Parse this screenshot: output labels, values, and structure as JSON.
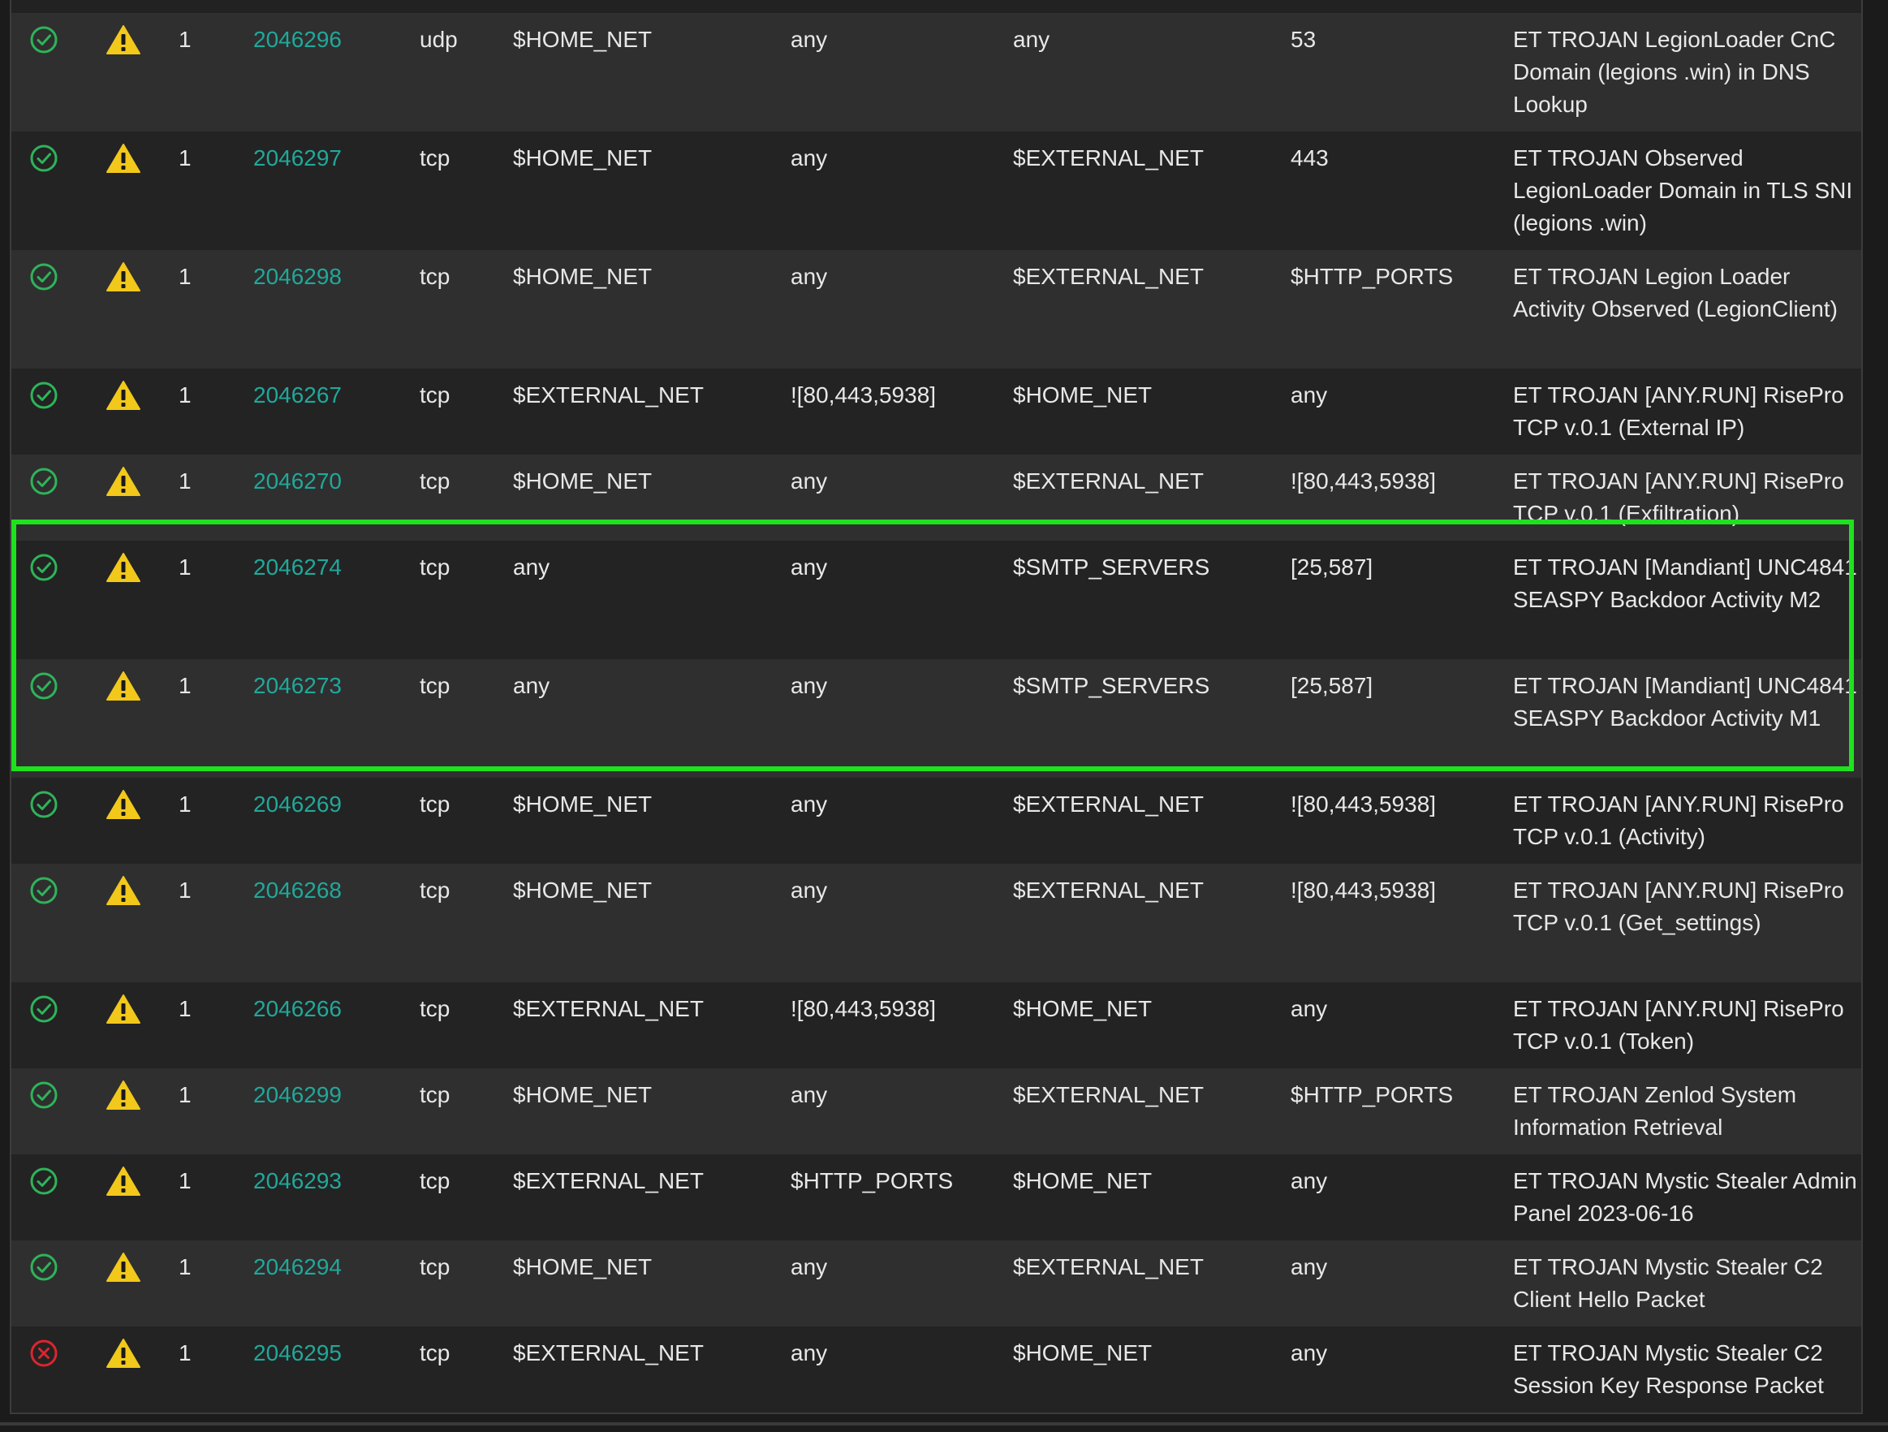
{
  "rules": [
    {
      "state": "enabled",
      "gid": "1",
      "sid": "2046296",
      "proto": "udp",
      "src": "$HOME_NET",
      "src_port": "any",
      "dst": "any",
      "dst_port": "53",
      "msg": "ET TROJAN LegionLoader CnC Domain (legions .win) in DNS Lookup"
    },
    {
      "state": "enabled",
      "gid": "1",
      "sid": "2046297",
      "proto": "tcp",
      "src": "$HOME_NET",
      "src_port": "any",
      "dst": "$EXTERNAL_NET",
      "dst_port": "443",
      "msg": "ET TROJAN Observed LegionLoader Domain in TLS SNI (legions .win)"
    },
    {
      "state": "enabled",
      "gid": "1",
      "sid": "2046298",
      "proto": "tcp",
      "src": "$HOME_NET",
      "src_port": "any",
      "dst": "$EXTERNAL_NET",
      "dst_port": "$HTTP_PORTS",
      "msg": "ET TROJAN Legion Loader Activity Observed (LegionClient)"
    },
    {
      "state": "enabled",
      "gid": "1",
      "sid": "2046267",
      "proto": "tcp",
      "src": "$EXTERNAL_NET",
      "src_port": "![80,443,5938]",
      "dst": "$HOME_NET",
      "dst_port": "any",
      "msg": "ET TROJAN [ANY.RUN] RisePro TCP v.0.1 (External IP)"
    },
    {
      "state": "enabled",
      "gid": "1",
      "sid": "2046270",
      "proto": "tcp",
      "src": "$HOME_NET",
      "src_port": "any",
      "dst": "$EXTERNAL_NET",
      "dst_port": "![80,443,5938]",
      "msg": "ET TROJAN [ANY.RUN] RisePro TCP v.0.1 (Exfiltration)"
    },
    {
      "state": "enabled",
      "gid": "1",
      "sid": "2046274",
      "proto": "tcp",
      "src": "any",
      "src_port": "any",
      "dst": "$SMTP_SERVERS",
      "dst_port": "[25,587]",
      "msg": "ET TROJAN [Mandiant] UNC4841 SEASPY Backdoor Activity M2"
    },
    {
      "state": "enabled",
      "gid": "1",
      "sid": "2046273",
      "proto": "tcp",
      "src": "any",
      "src_port": "any",
      "dst": "$SMTP_SERVERS",
      "dst_port": "[25,587]",
      "msg": "ET TROJAN [Mandiant] UNC4841 SEASPY Backdoor Activity M1"
    },
    {
      "state": "enabled",
      "gid": "1",
      "sid": "2046269",
      "proto": "tcp",
      "src": "$HOME_NET",
      "src_port": "any",
      "dst": "$EXTERNAL_NET",
      "dst_port": "![80,443,5938]",
      "msg": "ET TROJAN [ANY.RUN] RisePro TCP v.0.1 (Activity)"
    },
    {
      "state": "enabled",
      "gid": "1",
      "sid": "2046268",
      "proto": "tcp",
      "src": "$HOME_NET",
      "src_port": "any",
      "dst": "$EXTERNAL_NET",
      "dst_port": "![80,443,5938]",
      "msg": "ET TROJAN [ANY.RUN] RisePro TCP v.0.1 (Get_settings)"
    },
    {
      "state": "enabled",
      "gid": "1",
      "sid": "2046266",
      "proto": "tcp",
      "src": "$EXTERNAL_NET",
      "src_port": "![80,443,5938]",
      "dst": "$HOME_NET",
      "dst_port": "any",
      "msg": "ET TROJAN [ANY.RUN] RisePro TCP v.0.1 (Token)"
    },
    {
      "state": "enabled",
      "gid": "1",
      "sid": "2046299",
      "proto": "tcp",
      "src": "$HOME_NET",
      "src_port": "any",
      "dst": "$EXTERNAL_NET",
      "dst_port": "$HTTP_PORTS",
      "msg": "ET TROJAN Zenlod System Information Retrieval"
    },
    {
      "state": "enabled",
      "gid": "1",
      "sid": "2046293",
      "proto": "tcp",
      "src": "$EXTERNAL_NET",
      "src_port": "$HTTP_PORTS",
      "dst": "$HOME_NET",
      "dst_port": "any",
      "msg": "ET TROJAN Mystic Stealer Admin Panel 2023-06-16"
    },
    {
      "state": "enabled",
      "gid": "1",
      "sid": "2046294",
      "proto": "tcp",
      "src": "$HOME_NET",
      "src_port": "any",
      "dst": "$EXTERNAL_NET",
      "dst_port": "any",
      "msg": "ET TROJAN Mystic Stealer C2 Client Hello Packet"
    },
    {
      "state": "disabled",
      "gid": "1",
      "sid": "2046295",
      "proto": "tcp",
      "src": "$EXTERNAL_NET",
      "src_port": "any",
      "dst": "$HOME_NET",
      "dst_port": "any",
      "msg": "ET TROJAN Mystic Stealer C2 Session Key Response Packet"
    }
  ],
  "icons": {
    "enabled": "check-circle-icon",
    "disabled": "x-circle-icon",
    "action": "warning-triangle-icon"
  },
  "colors": {
    "enabled": "#2fb35a",
    "disabled": "#d9262e",
    "warning": "#f2c81b",
    "sid_link": "#20a89a",
    "highlight": "#1ee21e"
  }
}
